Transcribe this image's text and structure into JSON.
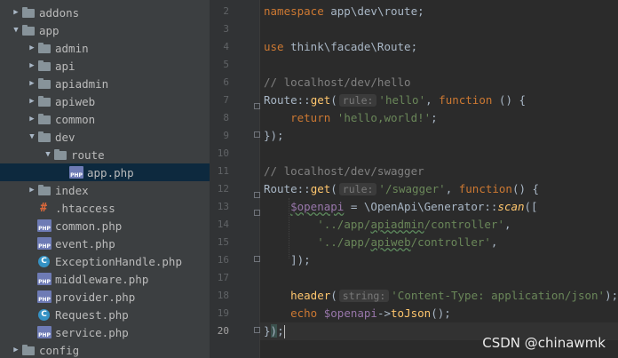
{
  "tree": [
    {
      "label": "addons",
      "icon": "folder",
      "arrow": "right",
      "indent": 0
    },
    {
      "label": "app",
      "icon": "folder",
      "arrow": "down",
      "indent": 0
    },
    {
      "label": "admin",
      "icon": "folder",
      "arrow": "right",
      "indent": 1
    },
    {
      "label": "api",
      "icon": "folder",
      "arrow": "right",
      "indent": 1
    },
    {
      "label": "apiadmin",
      "icon": "folder",
      "arrow": "right",
      "indent": 1
    },
    {
      "label": "apiweb",
      "icon": "folder",
      "arrow": "right",
      "indent": 1
    },
    {
      "label": "common",
      "icon": "folder",
      "arrow": "right",
      "indent": 1
    },
    {
      "label": "dev",
      "icon": "folder",
      "arrow": "down",
      "indent": 1
    },
    {
      "label": "route",
      "icon": "folder",
      "arrow": "down",
      "indent": 2
    },
    {
      "label": "app.php",
      "icon": "php",
      "arrow": "",
      "indent": 3,
      "selected": true
    },
    {
      "label": "index",
      "icon": "folder",
      "arrow": "right",
      "indent": 1
    },
    {
      "label": ".htaccess",
      "icon": "htaccess",
      "arrow": "",
      "indent": 1
    },
    {
      "label": "common.php",
      "icon": "php",
      "arrow": "",
      "indent": 1
    },
    {
      "label": "event.php",
      "icon": "php",
      "arrow": "",
      "indent": 1
    },
    {
      "label": "ExceptionHandle.php",
      "icon": "class",
      "arrow": "",
      "indent": 1
    },
    {
      "label": "middleware.php",
      "icon": "php",
      "arrow": "",
      "indent": 1
    },
    {
      "label": "provider.php",
      "icon": "php",
      "arrow": "",
      "indent": 1
    },
    {
      "label": "Request.php",
      "icon": "class",
      "arrow": "",
      "indent": 1
    },
    {
      "label": "service.php",
      "icon": "php",
      "arrow": "",
      "indent": 1
    },
    {
      "label": "config",
      "icon": "folder",
      "arrow": "right",
      "indent": 0
    }
  ],
  "php_icon_text": "PHP",
  "class_icon_text": "C",
  "line_numbers": [
    "2",
    "3",
    "4",
    "5",
    "6",
    "7",
    "8",
    "9",
    "10",
    "11",
    "12",
    "13",
    "14",
    "15",
    "16",
    "17",
    "18",
    "19",
    "20"
  ],
  "code": {
    "l2": {
      "kw": "namespace",
      "rest": " app\\dev\\route;"
    },
    "l4": {
      "kw": "use",
      "rest": " think\\facade\\Route;"
    },
    "l6": "// localhost/dev/hello",
    "l7": {
      "cls": "Route::",
      "fn": "get",
      "p1": "(",
      "hint": "rule:",
      "str": "'hello'",
      "p2": ", ",
      "kw": "function",
      "p3": " () {"
    },
    "l8": {
      "kw": "return",
      "str": "'hello,world!'",
      "p": ";"
    },
    "l9": "});",
    "l11": "// localhost/dev/swagger",
    "l12": {
      "cls": "Route::",
      "fn": "get",
      "p1": "(",
      "hint": "rule:",
      "str": "'/swagger'",
      "p2": ", ",
      "kw": "function",
      "p3": "() {"
    },
    "l13": {
      "var": "$openapi",
      "p1": " = \\OpenApi\\Generator::",
      "fn": "scan",
      "p2": "(["
    },
    "l14": {
      "s1": "'../app/",
      "s2": "apiadmin",
      "s3": "/controller'",
      "p": ","
    },
    "l15": {
      "s1": "'../app/",
      "s2": "apiweb",
      "s3": "/controller'",
      "p": ","
    },
    "l16": "]);",
    "l18": {
      "fn": "header",
      "p1": "(",
      "hint": "string:",
      "str": "'Content-Type: application/json'",
      "p2": ");"
    },
    "l19": {
      "kw": "echo",
      "var": "$openapi",
      "arrow": "->",
      "fn": "toJson",
      "p": "();"
    },
    "l20": {
      "a": "}",
      "b": ")",
      "c": ";"
    }
  },
  "watermark": "CSDN @chinawmk"
}
